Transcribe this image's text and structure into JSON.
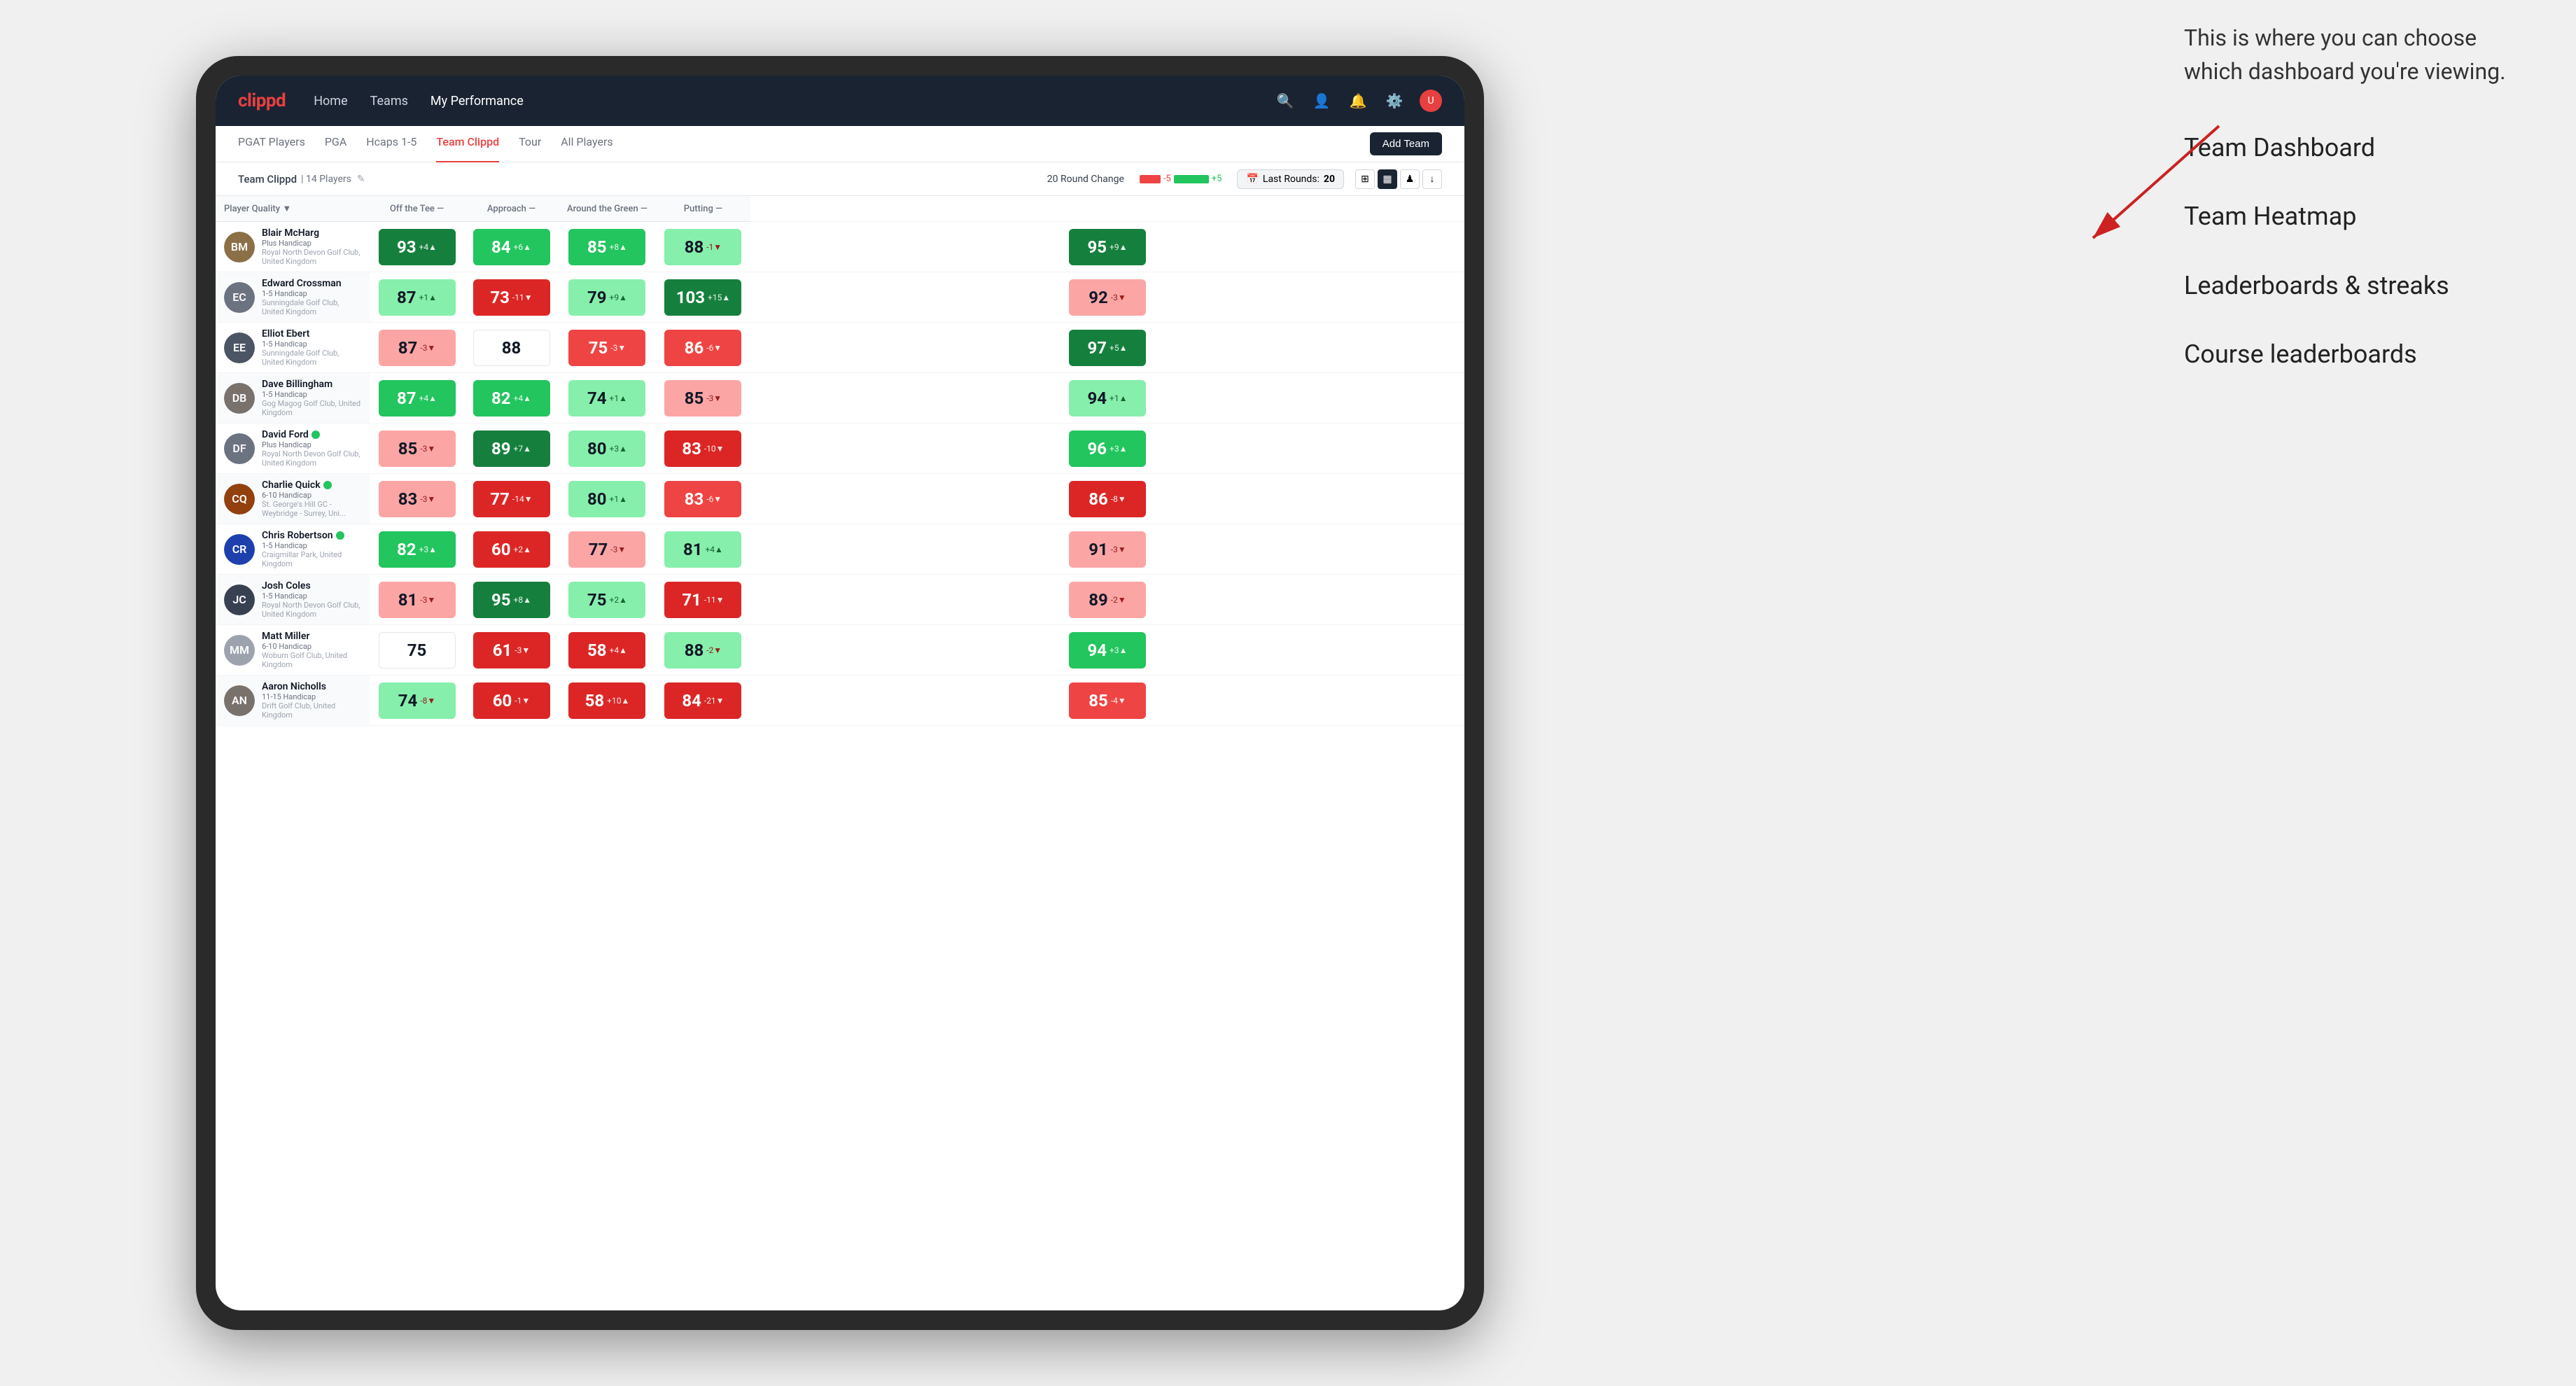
{
  "annotation": {
    "description": "This is where you can choose which dashboard you're viewing.",
    "items": [
      "Team Dashboard",
      "Team Heatmap",
      "Leaderboards & streaks",
      "Course leaderboards"
    ]
  },
  "navbar": {
    "logo": "clippd",
    "nav_items": [
      "Home",
      "Teams",
      "My Performance"
    ],
    "active_nav": "My Performance"
  },
  "subnav": {
    "items": [
      "PGAT Players",
      "PGA",
      "Hcaps 1-5",
      "Team Clippd",
      "Tour",
      "All Players"
    ],
    "active": "Team Clippd",
    "add_button": "Add Team"
  },
  "team_header": {
    "name": "Team Clippd",
    "count": "14 Players",
    "round_change_label": "20 Round Change",
    "round_change_neg": "-5",
    "round_change_pos": "+5",
    "last_rounds_label": "Last Rounds:",
    "last_rounds_value": "20"
  },
  "table": {
    "headers": {
      "player": "Player Quality ▼",
      "off_tee": "Off the Tee —",
      "approach": "Approach —",
      "around_green": "Around the Green —",
      "putting": "Putting —"
    },
    "players": [
      {
        "name": "Blair McHarg",
        "handicap": "Plus Handicap",
        "club": "Royal North Devon Golf Club, United Kingdom",
        "initials": "BM",
        "color": "#8b6f47",
        "player_quality": {
          "value": 93,
          "change": "+4",
          "direction": "up",
          "bg": "green-dark"
        },
        "off_tee": {
          "value": 84,
          "change": "+6",
          "direction": "up",
          "bg": "green-med"
        },
        "approach": {
          "value": 85,
          "change": "+8",
          "direction": "up",
          "bg": "green-med"
        },
        "around_green": {
          "value": 88,
          "change": "-1",
          "direction": "down",
          "bg": "green-light"
        },
        "putting": {
          "value": 95,
          "change": "+9",
          "direction": "up",
          "bg": "green-dark"
        }
      },
      {
        "name": "Edward Crossman",
        "handicap": "1-5 Handicap",
        "club": "Sunningdale Golf Club, United Kingdom",
        "initials": "EC",
        "color": "#6b7280",
        "player_quality": {
          "value": 87,
          "change": "+1",
          "direction": "up",
          "bg": "green-light"
        },
        "off_tee": {
          "value": 73,
          "change": "-11",
          "direction": "down",
          "bg": "red-dark"
        },
        "approach": {
          "value": 79,
          "change": "+9",
          "direction": "up",
          "bg": "green-light"
        },
        "around_green": {
          "value": 103,
          "change": "+15",
          "direction": "up",
          "bg": "green-dark"
        },
        "putting": {
          "value": 92,
          "change": "-3",
          "direction": "down",
          "bg": "red-light"
        }
      },
      {
        "name": "Elliot Ebert",
        "handicap": "1-5 Handicap",
        "club": "Sunningdale Golf Club, United Kingdom",
        "initials": "EE",
        "color": "#4b5563",
        "player_quality": {
          "value": 87,
          "change": "-3",
          "direction": "down",
          "bg": "red-light"
        },
        "off_tee": {
          "value": 88,
          "change": "",
          "direction": "none",
          "bg": "white"
        },
        "approach": {
          "value": 75,
          "change": "-3",
          "direction": "down",
          "bg": "red-med"
        },
        "around_green": {
          "value": 86,
          "change": "-6",
          "direction": "down",
          "bg": "red-med"
        },
        "putting": {
          "value": 97,
          "change": "+5",
          "direction": "up",
          "bg": "green-dark"
        }
      },
      {
        "name": "Dave Billingham",
        "handicap": "1-5 Handicap",
        "club": "Gog Magog Golf Club, United Kingdom",
        "initials": "DB",
        "color": "#78716c",
        "player_quality": {
          "value": 87,
          "change": "+4",
          "direction": "up",
          "bg": "green-med"
        },
        "off_tee": {
          "value": 82,
          "change": "+4",
          "direction": "up",
          "bg": "green-med"
        },
        "approach": {
          "value": 74,
          "change": "+1",
          "direction": "up",
          "bg": "green-light"
        },
        "around_green": {
          "value": 85,
          "change": "-3",
          "direction": "down",
          "bg": "red-light"
        },
        "putting": {
          "value": 94,
          "change": "+1",
          "direction": "up",
          "bg": "green-light"
        }
      },
      {
        "name": "David Ford",
        "handicap": "Plus Handicap",
        "club": "Royal North Devon Golf Club, United Kingdom",
        "initials": "DF",
        "color": "#6b7280",
        "verified": true,
        "player_quality": {
          "value": 85,
          "change": "-3",
          "direction": "down",
          "bg": "red-light"
        },
        "off_tee": {
          "value": 89,
          "change": "+7",
          "direction": "up",
          "bg": "green-dark"
        },
        "approach": {
          "value": 80,
          "change": "+3",
          "direction": "up",
          "bg": "green-light"
        },
        "around_green": {
          "value": 83,
          "change": "-10",
          "direction": "down",
          "bg": "red-dark"
        },
        "putting": {
          "value": 96,
          "change": "+3",
          "direction": "up",
          "bg": "green-med"
        }
      },
      {
        "name": "Charlie Quick",
        "handicap": "6-10 Handicap",
        "club": "St. George's Hill GC - Weybridge - Surrey, Uni...",
        "initials": "CQ",
        "color": "#92400e",
        "verified": true,
        "player_quality": {
          "value": 83,
          "change": "-3",
          "direction": "down",
          "bg": "red-light"
        },
        "off_tee": {
          "value": 77,
          "change": "-14",
          "direction": "down",
          "bg": "red-dark"
        },
        "approach": {
          "value": 80,
          "change": "+1",
          "direction": "up",
          "bg": "green-light"
        },
        "around_green": {
          "value": 83,
          "change": "-6",
          "direction": "down",
          "bg": "red-med"
        },
        "putting": {
          "value": 86,
          "change": "-8",
          "direction": "down",
          "bg": "red-dark"
        }
      },
      {
        "name": "Chris Robertson",
        "handicap": "1-5 Handicap",
        "club": "Craigmillar Park, United Kingdom",
        "initials": "CR",
        "color": "#1e40af",
        "verified": true,
        "player_quality": {
          "value": 82,
          "change": "+3",
          "direction": "up",
          "bg": "green-med"
        },
        "off_tee": {
          "value": 60,
          "change": "+2",
          "direction": "up",
          "bg": "red-dark"
        },
        "approach": {
          "value": 77,
          "change": "-3",
          "direction": "down",
          "bg": "red-light"
        },
        "around_green": {
          "value": 81,
          "change": "+4",
          "direction": "up",
          "bg": "green-light"
        },
        "putting": {
          "value": 91,
          "change": "-3",
          "direction": "down",
          "bg": "red-light"
        }
      },
      {
        "name": "Josh Coles",
        "handicap": "1-5 Handicap",
        "club": "Royal North Devon Golf Club, United Kingdom",
        "initials": "JC",
        "color": "#374151",
        "player_quality": {
          "value": 81,
          "change": "-3",
          "direction": "down",
          "bg": "red-light"
        },
        "off_tee": {
          "value": 95,
          "change": "+8",
          "direction": "up",
          "bg": "green-dark"
        },
        "approach": {
          "value": 75,
          "change": "+2",
          "direction": "up",
          "bg": "green-light"
        },
        "around_green": {
          "value": 71,
          "change": "-11",
          "direction": "down",
          "bg": "red-dark"
        },
        "putting": {
          "value": 89,
          "change": "-2",
          "direction": "down",
          "bg": "red-light"
        }
      },
      {
        "name": "Matt Miller",
        "handicap": "6-10 Handicap",
        "club": "Woburn Golf Club, United Kingdom",
        "initials": "MM",
        "color": "#9ca3af",
        "player_quality": {
          "value": 75,
          "change": "",
          "direction": "none",
          "bg": "white"
        },
        "off_tee": {
          "value": 61,
          "change": "-3",
          "direction": "down",
          "bg": "red-dark"
        },
        "approach": {
          "value": 58,
          "change": "+4",
          "direction": "up",
          "bg": "red-dark"
        },
        "around_green": {
          "value": 88,
          "change": "-2",
          "direction": "down",
          "bg": "green-light"
        },
        "putting": {
          "value": 94,
          "change": "+3",
          "direction": "up",
          "bg": "green-med"
        }
      },
      {
        "name": "Aaron Nicholls",
        "handicap": "11-15 Handicap",
        "club": "Drift Golf Club, United Kingdom",
        "initials": "AN",
        "color": "#78716c",
        "player_quality": {
          "value": 74,
          "change": "-8",
          "direction": "down",
          "bg": "green-light"
        },
        "off_tee": {
          "value": 60,
          "change": "-1",
          "direction": "down",
          "bg": "red-dark"
        },
        "approach": {
          "value": 58,
          "change": "+10",
          "direction": "up",
          "bg": "red-dark"
        },
        "around_green": {
          "value": 84,
          "change": "-21",
          "direction": "down",
          "bg": "red-dark"
        },
        "putting": {
          "value": 85,
          "change": "-4",
          "direction": "down",
          "bg": "red-med"
        }
      }
    ]
  }
}
